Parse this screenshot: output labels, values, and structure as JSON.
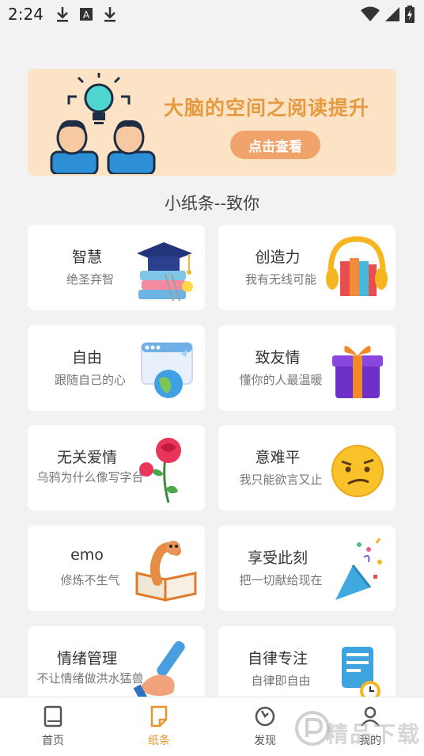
{
  "status_bar": {
    "time": "2:24"
  },
  "banner": {
    "title": "大脑的空间之阅读提升",
    "button": "点击查看"
  },
  "section_title": "小纸条--致你",
  "cards": [
    {
      "title": "智慧",
      "subtitle": "绝圣弃智",
      "icon": "books-graduation-cap-icon"
    },
    {
      "title": "创造力",
      "subtitle": "我有无线可能",
      "icon": "books-headphones-icon"
    },
    {
      "title": "自由",
      "subtitle": "跟随自己的心",
      "icon": "browser-globe-icon"
    },
    {
      "title": "致友情",
      "subtitle": "懂你的人最温暖",
      "icon": "gift-box-icon"
    },
    {
      "title": "无关爱情",
      "subtitle": "乌鸦为什么像写字台",
      "icon": "rose-icon"
    },
    {
      "title": "意难平",
      "subtitle": "我只能欲言又止",
      "icon": "confused-face-icon"
    },
    {
      "title": "emo",
      "subtitle": "修炼不生气",
      "icon": "worm-book-icon"
    },
    {
      "title": "享受此刻",
      "subtitle": "把一切献给现在",
      "icon": "party-popper-icon"
    },
    {
      "title": "情绪管理",
      "subtitle": "不让情绪做洪水猛兽",
      "icon": "hand-scroll-icon"
    },
    {
      "title": "自律专注",
      "subtitle": "自律即自由",
      "icon": "notebook-clock-icon"
    }
  ],
  "bottom_nav": [
    {
      "label": "首页",
      "active": false
    },
    {
      "label": "纸条",
      "active": true
    },
    {
      "label": "发现",
      "active": false
    },
    {
      "label": "我的",
      "active": false
    }
  ],
  "watermark": "精品下载",
  "colors": {
    "accent": "#e8962c",
    "banner_bg": "#fde3c6",
    "banner_button": "#f0a36a"
  }
}
